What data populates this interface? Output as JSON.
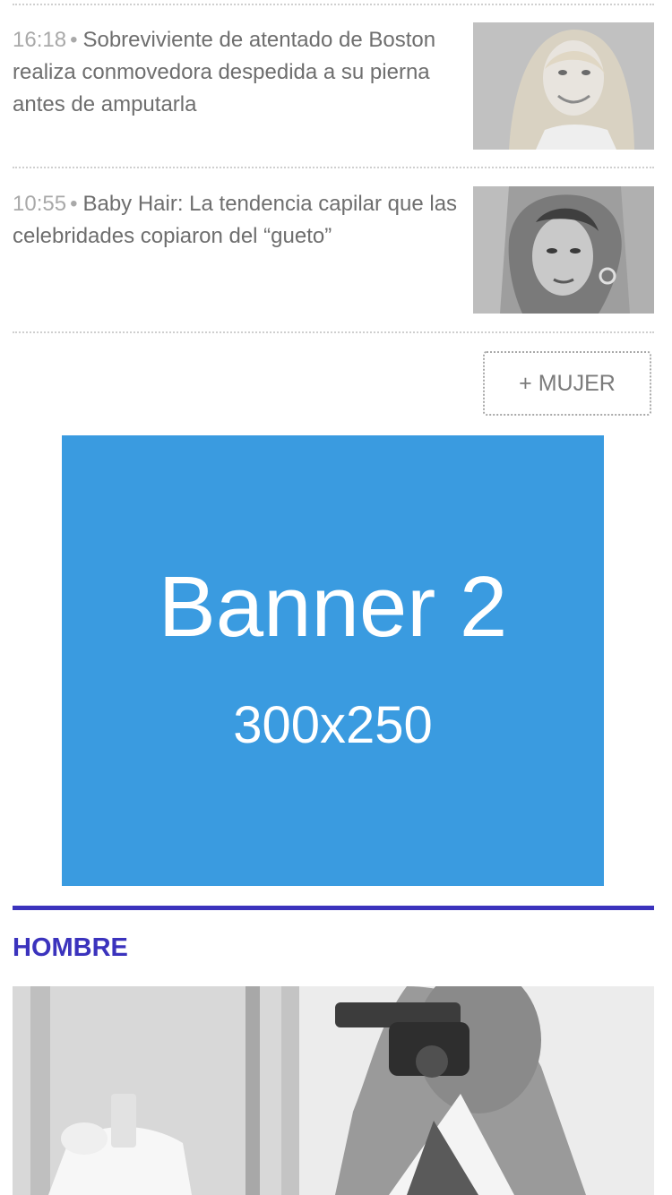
{
  "news": [
    {
      "time": "16:18",
      "bullet": "•",
      "headline": "Sobreviviente de atentado de Boston realiza conmovedora despedida a su pierna antes de amputarla"
    },
    {
      "time": "10:55",
      "bullet": "•",
      "headline": "Baby Hair: La tendencia capilar que las celebridades copiaron del “gueto”"
    }
  ],
  "more_button": {
    "label": "+ MUJER"
  },
  "banner": {
    "title": "Banner 2",
    "size": "300x250",
    "color": "#3a9be0"
  },
  "section": {
    "title": "HOMBRE",
    "accent_color": "#3b33bd"
  }
}
